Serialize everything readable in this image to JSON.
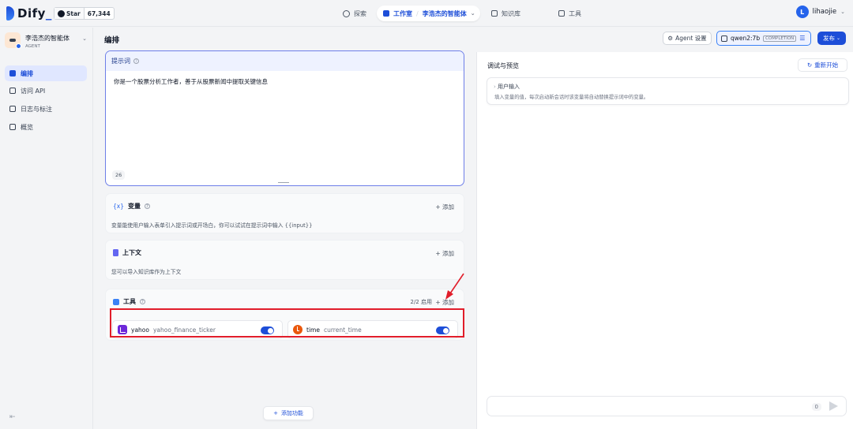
{
  "topbar": {
    "brand": "Dify",
    "github_star_label": "Star",
    "github_star_count": "67,344",
    "nav": {
      "explore": "探索",
      "studio": "工作室",
      "current_app": "李浩杰的智能体",
      "knowledge": "知识库",
      "tools": "工具"
    },
    "user": {
      "initial": "L",
      "name": "lihaojie"
    }
  },
  "sidebar": {
    "app_name": "李浩杰的智能体",
    "app_type": "AGENT",
    "items": [
      {
        "label": "编排",
        "icon": "layout-icon",
        "active": true
      },
      {
        "label": "访问 API",
        "icon": "terminal-icon",
        "active": false
      },
      {
        "label": "日志与标注",
        "icon": "log-icon",
        "active": false
      },
      {
        "label": "概览",
        "icon": "chart-icon",
        "active": false
      }
    ]
  },
  "main": {
    "title": "编排",
    "prompt": {
      "header": "提示词",
      "text": "你是一个股票分析工作者，善于从股票新闻中提取关键信息",
      "char_count": "26"
    },
    "variables": {
      "icon_text": "{x}",
      "title": "变量",
      "add_label": "+ 添加",
      "description": "变量能使用户输入表单引入提示词或开场白，你可以试试在提示词中输入 {{input}}"
    },
    "context": {
      "title": "上下文",
      "add_label": "+ 添加",
      "description": "您可以导入知识库作为上下文"
    },
    "tools": {
      "title": "工具",
      "enabled_count": "2/2 启用",
      "add_label": "+ 添加",
      "items": [
        {
          "provider": "yahoo",
          "function": "yahoo_finance_ticker",
          "enabled": true
        },
        {
          "provider": "time",
          "function": "current_time",
          "enabled": true
        }
      ]
    },
    "add_feature_label": "添加功能"
  },
  "header_actions": {
    "agent_settings": "Agent 设置",
    "model_name": "qwen2:7b",
    "model_mode": "COMPLETION",
    "publish": "发布"
  },
  "debug": {
    "title": "调试与预览",
    "restart": "重新开始",
    "user_input_title": "用户输入",
    "user_input_desc": "填入变量的值，每次启动新会话时该变量将自动替换提示词中的变量。",
    "char_count": "0"
  },
  "colors": {
    "accent": "#1d4ed8",
    "highlight_box": "#e11d2a"
  }
}
